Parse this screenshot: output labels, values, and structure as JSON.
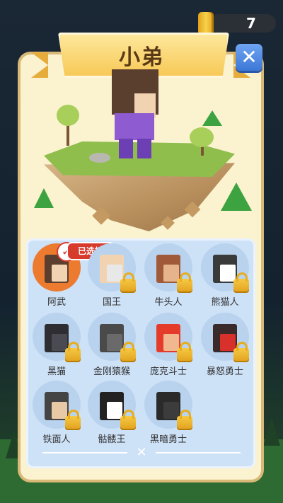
{
  "currency": {
    "count": "7",
    "icon": "coin-icon"
  },
  "panel": {
    "title": "小弟"
  },
  "selected_badge": "已选择",
  "characters": [
    {
      "name": "阿武",
      "selected": true,
      "locked": false,
      "color": "#5a3e2e",
      "face": "#f1d3b1"
    },
    {
      "name": "国王",
      "selected": false,
      "locked": true,
      "color": "#f1d3b1",
      "face": "#e8e8e8"
    },
    {
      "name": "牛头人",
      "selected": false,
      "locked": true,
      "color": "#a05a3a",
      "face": "#e6b48c"
    },
    {
      "name": "熊猫人",
      "selected": false,
      "locked": true,
      "color": "#3a3a3a",
      "face": "#ffffff"
    },
    {
      "name": "黑猫",
      "selected": false,
      "locked": true,
      "color": "#2e2e32",
      "face": "#4a4a52"
    },
    {
      "name": "金刚猿猴",
      "selected": false,
      "locked": true,
      "color": "#4a4a4a",
      "face": "#6a6a6a"
    },
    {
      "name": "庞克斗士",
      "selected": false,
      "locked": true,
      "color": "#e53b2b",
      "face": "#f1b88f"
    },
    {
      "name": "暴怒勇士",
      "selected": false,
      "locked": true,
      "color": "#3b2a2a",
      "face": "#d8302a"
    },
    {
      "name": "铁面人",
      "selected": false,
      "locked": true,
      "color": "#444444",
      "face": "#e8c9a6"
    },
    {
      "name": "骷髅王",
      "selected": false,
      "locked": true,
      "color": "#222222",
      "face": "#ffffff"
    },
    {
      "name": "黑暗勇士",
      "selected": false,
      "locked": true,
      "color": "#2a2a2a",
      "face": "#3c3c3c"
    }
  ]
}
